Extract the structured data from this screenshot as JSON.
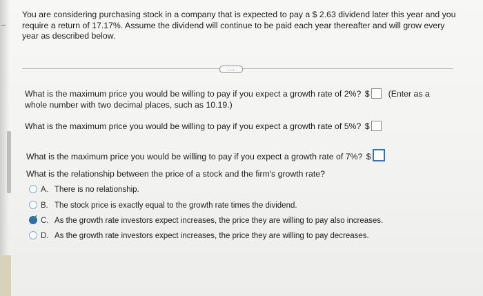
{
  "intro": "You are considering purchasing stock in a company that is expected to pay a $ 2.63 dividend later this year and you require a return of  17.17%.  Assume the dividend will continue to be paid each year thereafter and will grow every year as described below.",
  "more_button_label": "....",
  "questions": [
    {
      "text": "What is the maximum price you would be willing to pay if you expect a growth rate of 2%?",
      "currency": "$",
      "answer": "",
      "hint": "(Enter as a whole number with two decimal places, such as 10.19.)"
    },
    {
      "text": "What is the maximum price you would be willing to pay if you expect a growth rate of 5%?",
      "currency": "$",
      "answer": ""
    },
    {
      "text": "What is the maximum price you would be willing to pay if you expect a growth rate of 7%?",
      "currency": "$",
      "answer": ""
    }
  ],
  "mc_question": "What is the relationship between the price of a stock and the firm's growth rate?",
  "options": [
    {
      "letter": "A.",
      "text": "There is no relationship.",
      "selected": false
    },
    {
      "letter": "B.",
      "text": "The stock price is exactly equal to the growth rate times the dividend.",
      "selected": false
    },
    {
      "letter": "C.",
      "text": "As the growth rate investors expect increases, the price they are willing to pay also increases.",
      "selected": true
    },
    {
      "letter": "D.",
      "text": "As the growth rate investors expect increases, the price they are willing to pay decreases.",
      "selected": false
    }
  ],
  "colors": {
    "accent": "#2c78c5",
    "check": "#4f8a2b"
  }
}
